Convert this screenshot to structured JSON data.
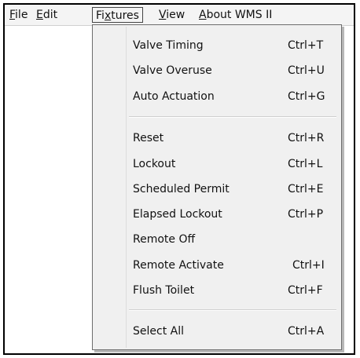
{
  "menubar": {
    "file": {
      "pre": "",
      "key": "F",
      "post": "ile"
    },
    "edit": {
      "pre": "",
      "key": "E",
      "post": "dit"
    },
    "fixtures": {
      "pre": "Fi",
      "key": "x",
      "post": "tures"
    },
    "view": {
      "pre": "",
      "key": "V",
      "post": "iew"
    },
    "about": {
      "pre": "",
      "key": "A",
      "post": "bout WMS II"
    }
  },
  "fixtures_menu": {
    "items": [
      {
        "label": "Valve Timing",
        "shortcut": "Ctrl+T"
      },
      {
        "label": "Valve Overuse",
        "shortcut": "Ctrl+U"
      },
      {
        "label": "Auto Actuation",
        "shortcut": "Ctrl+G"
      },
      {
        "label": "Reset",
        "shortcut": "Ctrl+R"
      },
      {
        "label": "Lockout",
        "shortcut": "Ctrl+L"
      },
      {
        "label": "Scheduled Permit",
        "shortcut": "Ctrl+E"
      },
      {
        "label": "Elapsed Lockout",
        "shortcut": "Ctrl+P"
      },
      {
        "label": "Remote Off",
        "shortcut": ""
      },
      {
        "label": "Remote Activate",
        "shortcut": "Ctrl+I"
      },
      {
        "label": "Flush Toilet",
        "shortcut": "Ctrl+F"
      },
      {
        "label": "Select All",
        "shortcut": "Ctrl+A"
      }
    ]
  }
}
